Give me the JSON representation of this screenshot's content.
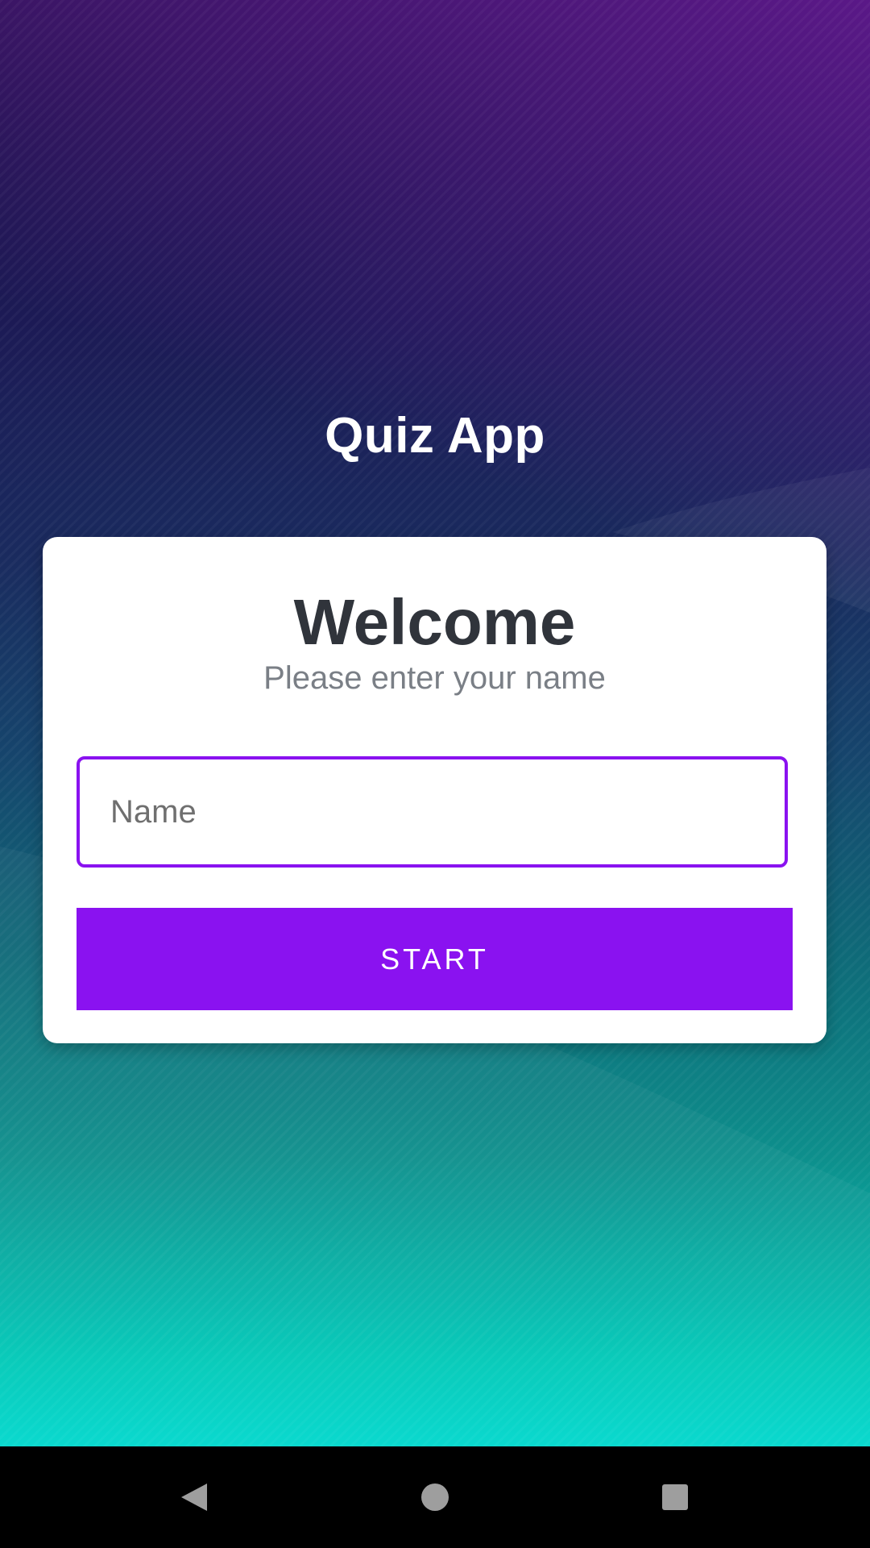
{
  "app": {
    "title": "Quiz App"
  },
  "card": {
    "heading": "Welcome",
    "subtitle": "Please enter your name",
    "name_input": {
      "placeholder": "Name",
      "value": ""
    },
    "start_button_label": "START"
  },
  "navigation_bar": {
    "buttons": [
      {
        "icon": "back-triangle-icon"
      },
      {
        "icon": "home-circle-icon"
      },
      {
        "icon": "recents-square-icon"
      }
    ]
  },
  "colors": {
    "accent": "#8a12f0",
    "heading_text": "#30343b",
    "subtitle_text": "#7a7f86",
    "card_background": "#ffffff",
    "nav_bar": "#000000",
    "nav_icons": "#9e9e9e"
  }
}
